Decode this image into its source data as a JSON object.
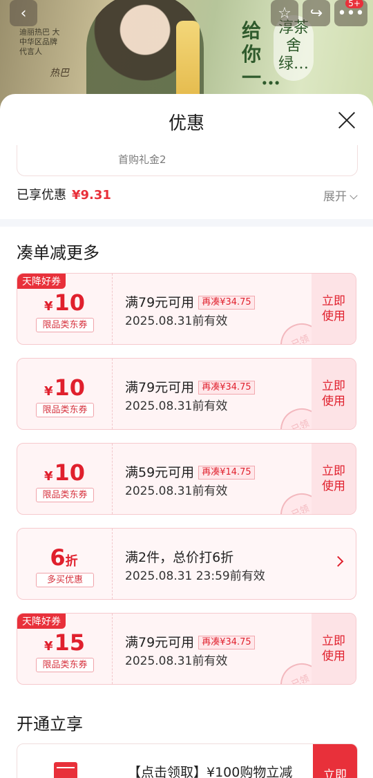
{
  "banner": {
    "side_text": "迪丽热巴 大中华区品牌代言人",
    "signature": "热巴",
    "slogan": "给你一…",
    "brand": "淳茶舍 绿…",
    "badge": "5+"
  },
  "sheet": {
    "title": "优惠",
    "gift_label": "首购礼金2",
    "enjoyed_label": "已享优惠",
    "enjoyed_amount": "¥9.31",
    "expand_label": "展开"
  },
  "sections": {
    "more": "凑单减更多",
    "membership": "开通立享"
  },
  "coupons": [
    {
      "ribbon": "天降好券",
      "symbol": "¥",
      "amount": "10",
      "tag": "限品类东券",
      "condition": "满79元可用",
      "extra": "再凑¥34.75",
      "date": "2025.08.31前有效",
      "action": "立即使用",
      "stamp": "已领"
    },
    {
      "ribbon": "",
      "symbol": "¥",
      "amount": "10",
      "tag": "限品类东券",
      "condition": "满79元可用",
      "extra": "再凑¥34.75",
      "date": "2025.08.31前有效",
      "action": "立即使用",
      "stamp": "已领"
    },
    {
      "ribbon": "",
      "symbol": "¥",
      "amount": "10",
      "tag": "限品类东券",
      "condition": "满59元可用",
      "extra": "再凑¥14.75",
      "date": "2025.08.31前有效",
      "action": "立即使用",
      "stamp": "已领"
    },
    {
      "ribbon": "",
      "symbol": "",
      "amount": "6",
      "unit": "折",
      "tag": "多买优惠",
      "condition": "满2件，总价打6折",
      "extra": "",
      "date": "2025.08.31 23:59前有效",
      "action": "",
      "stamp": ""
    },
    {
      "ribbon": "天降好券",
      "symbol": "¥",
      "amount": "15",
      "tag": "限品类东券",
      "condition": "满79元可用",
      "extra": "再凑¥34.75",
      "date": "2025.08.31前有效",
      "action": "立即使用",
      "stamp": "已领"
    }
  ],
  "membership_card": {
    "text": "【点击领取】¥100购物立减",
    "action": "立即"
  },
  "icons": [
    "back-icon",
    "star-icon",
    "share-icon",
    "more-icon",
    "close-icon",
    "chevron-down-icon",
    "chevron-right-icon",
    "card-icon"
  ],
  "colors": {
    "accent": "#e8303a",
    "coupon_bg": "#fff4f5",
    "divider": "#f4f6fa"
  }
}
